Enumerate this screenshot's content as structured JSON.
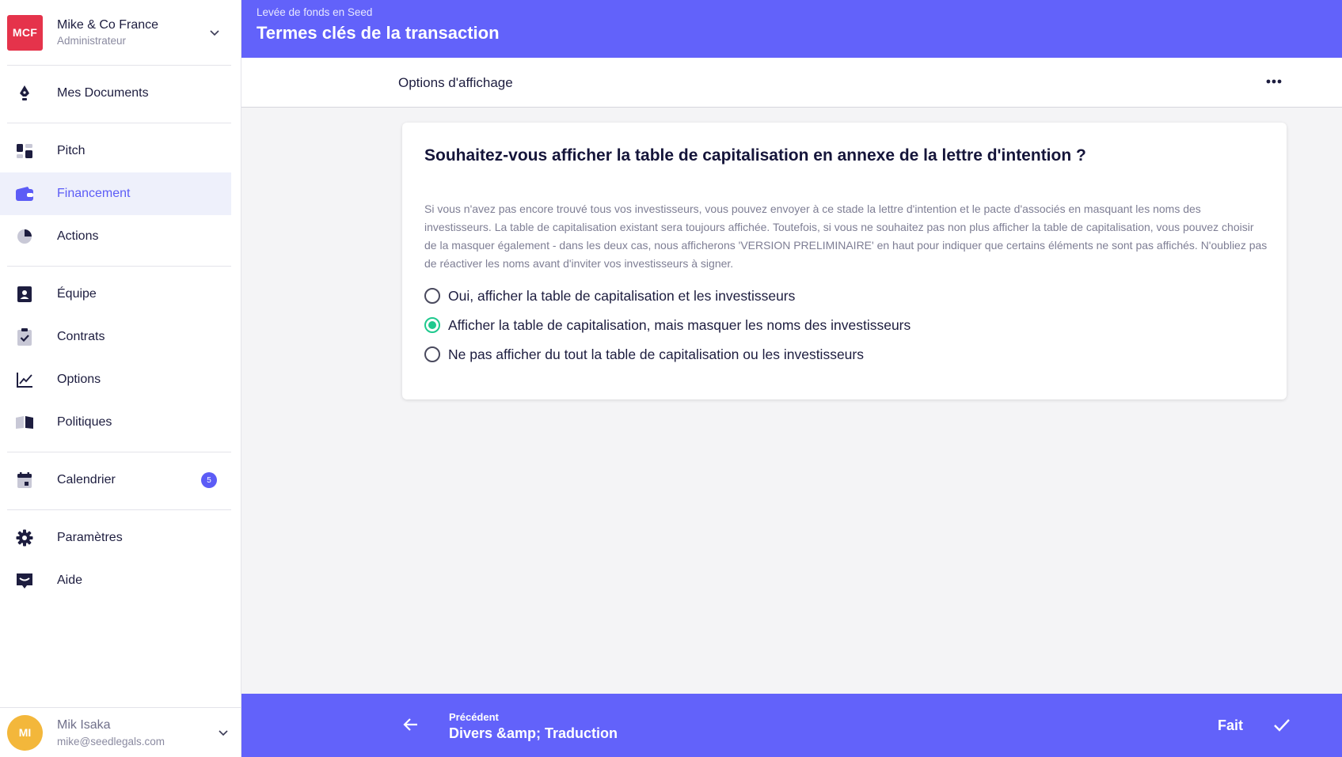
{
  "org": {
    "initials": "MCF",
    "name": "Mike & Co France",
    "role": "Administrateur"
  },
  "nav": [
    {
      "label": "Mes Documents",
      "icon": "pen-nib-icon"
    },
    {
      "label": "Pitch",
      "icon": "dashboard-icon"
    },
    {
      "label": "Financement",
      "icon": "wallet-icon",
      "active": true
    },
    {
      "label": "Actions",
      "icon": "pie-chart-icon"
    },
    {
      "label": "Équipe",
      "icon": "person-badge-icon"
    },
    {
      "label": "Contrats",
      "icon": "clipboard-check-icon"
    },
    {
      "label": "Options",
      "icon": "line-chart-icon"
    },
    {
      "label": "Politiques",
      "icon": "book-icon"
    },
    {
      "label": "Calendrier",
      "icon": "calendar-icon",
      "badge": "5"
    },
    {
      "label": "Paramètres",
      "icon": "gear-icon"
    },
    {
      "label": "Aide",
      "icon": "chat-icon"
    }
  ],
  "user": {
    "initials": "MI",
    "name": "Mik Isaka",
    "email": "mike@seedlegals.com"
  },
  "header": {
    "breadcrumb": "Levée de fonds en Seed",
    "title": "Termes clés de la transaction"
  },
  "subbar": {
    "label": "Options d'affichage"
  },
  "card": {
    "question": "Souhaitez-vous afficher la table de capitalisation en annexe de la lettre d'intention ?",
    "description": "Si vous n'avez pas encore trouvé tous vos investisseurs, vous pouvez envoyer à ce stade la lettre d'intention et le pacte d'associés en masquant les noms des investisseurs. La table de capitalisation existant sera toujours affichée. Toutefois, si vous ne souhaitez pas non plus afficher la table de capitalisation, vous pouvez choisir de la masquer également - dans les deux cas, nous afficherons 'VERSION PRELIMINAIRE' en haut pour indiquer que certains éléments ne sont pas affichés. N'oubliez pas de réactiver les noms avant d'inviter vos investisseurs à signer.",
    "options": [
      {
        "label": "Oui, afficher la table de capitalisation et les investisseurs",
        "checked": false
      },
      {
        "label": "Afficher la table de capitalisation, mais masquer les noms des investisseurs",
        "checked": true
      },
      {
        "label": "Ne pas afficher du tout la table de capitalisation ou les investisseurs",
        "checked": false
      }
    ]
  },
  "footer": {
    "prev_small": "Précédent",
    "prev_big": "Divers &amp; Traduction",
    "done_label": "Fait"
  },
  "colors": {
    "accent": "#6262fa",
    "active_text": "#5c5cf6",
    "radio_checked": "#1fc98e",
    "org_logo": "#e5334b",
    "avatar": "#f3b73b"
  }
}
